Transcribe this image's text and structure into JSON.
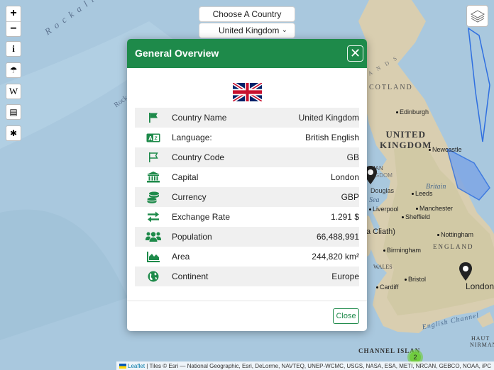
{
  "map": {
    "labels": {
      "rockall_rise": "Rockall Rise",
      "rock_partial": "Rock",
      "country": "UNITED\nKINGDOM",
      "scotland_partial": "COTLAND",
      "scotland_top": "A N D S",
      "england": "ENGLAND",
      "wales": "WALES",
      "britain": "Britain",
      "douglas": "Douglas",
      "sea": "Sea",
      "ingdom_partial": "INGDOM",
      "man_partial": "MAN",
      "cliath": "a Cliath)",
      "english_channel": "English Channel",
      "channel_islands": "CHANNEL ISLAN",
      "nirman": "NIRMAN",
      "haut": "HAUT"
    },
    "cities": [
      "Edinburgh",
      "Newcastle",
      "Leeds",
      "Liverpool",
      "Manchester",
      "Sheffield",
      "Nottingham",
      "Birmingham",
      "Cardiff",
      "Bristol",
      "London"
    ],
    "cluster_count": "2"
  },
  "controls": {
    "zoom_in": "+",
    "zoom_out": "−",
    "info": "i",
    "weather": "☂",
    "wikipedia": "W",
    "news": "▤",
    "covid": "✱"
  },
  "chooser": {
    "button_label": "Choose A Country",
    "selected_country": "United Kingdom"
  },
  "modal": {
    "title": "General Overview",
    "close_x": "✕",
    "close_button": "Close",
    "rows": [
      {
        "icon": "flag-icon",
        "label": "Country Name",
        "value": "United Kingdom"
      },
      {
        "icon": "language-icon",
        "label": "Language:",
        "value": "British English"
      },
      {
        "icon": "flag-outline-icon",
        "label": "Country Code",
        "value": "GB"
      },
      {
        "icon": "landmark-icon",
        "label": "Capital",
        "value": "London"
      },
      {
        "icon": "coins-icon",
        "label": "Currency",
        "value": "GBP"
      },
      {
        "icon": "exchange-icon",
        "label": "Exchange Rate",
        "value": "1.291 $"
      },
      {
        "icon": "people-icon",
        "label": "Population",
        "value": "66,488,991"
      },
      {
        "icon": "area-chart-icon",
        "label": "Area",
        "value": "244,820 km²"
      },
      {
        "icon": "globe-icon",
        "label": "Continent",
        "value": "Europe"
      }
    ]
  },
  "attribution": {
    "leaflet": "Leaflet",
    "text": "| Tiles © Esri — National Geographic, Esri, DeLorme, NAVTEQ, UNEP-WCMC, USGS, NASA, ESA, METI, NRCAN, GEBCO, NOAA, iPC"
  },
  "colors": {
    "accent": "#1e8a4a",
    "ocean": "#a9c8de",
    "land": "#d9ceb0"
  }
}
